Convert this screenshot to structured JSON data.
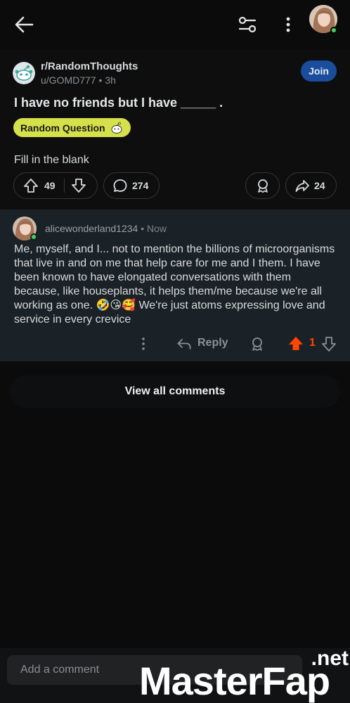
{
  "header": {
    "back_icon": "arrow-left-icon",
    "filter_icon": "sliders-icon",
    "more_icon": "vertical-dots-icon"
  },
  "post": {
    "subreddit": "r/RandomThoughts",
    "author": "u/GOMD777",
    "age": "3h",
    "join_label": "Join",
    "title": "I have no friends but I have _____ .",
    "flair": "Random Question",
    "body": "Fill in the blank",
    "upvotes": "49",
    "comments": "274",
    "shares": "24"
  },
  "comment": {
    "username": "alicewonderland1234",
    "time": "Now",
    "text": "Me, myself, and I... not to mention the billions of microorganisms that live in and on me that help care for me and I them. I have been known to have elongated conversations with them because, like houseplants, it helps them/me because we're all working as one. 🤣😘🥰 We're just atoms expressing love and service in every crevice",
    "reply_label": "Reply",
    "score": "1"
  },
  "view_all_label": "View all comments",
  "composer": {
    "placeholder": "Add a comment"
  },
  "watermark": {
    "main": "MasterFap",
    "tld": ".net"
  },
  "colors": {
    "accent_upvote": "#ff4500",
    "join_button": "#1a4d9c",
    "flair_bg": "#d6e04a",
    "online": "#46d160"
  }
}
